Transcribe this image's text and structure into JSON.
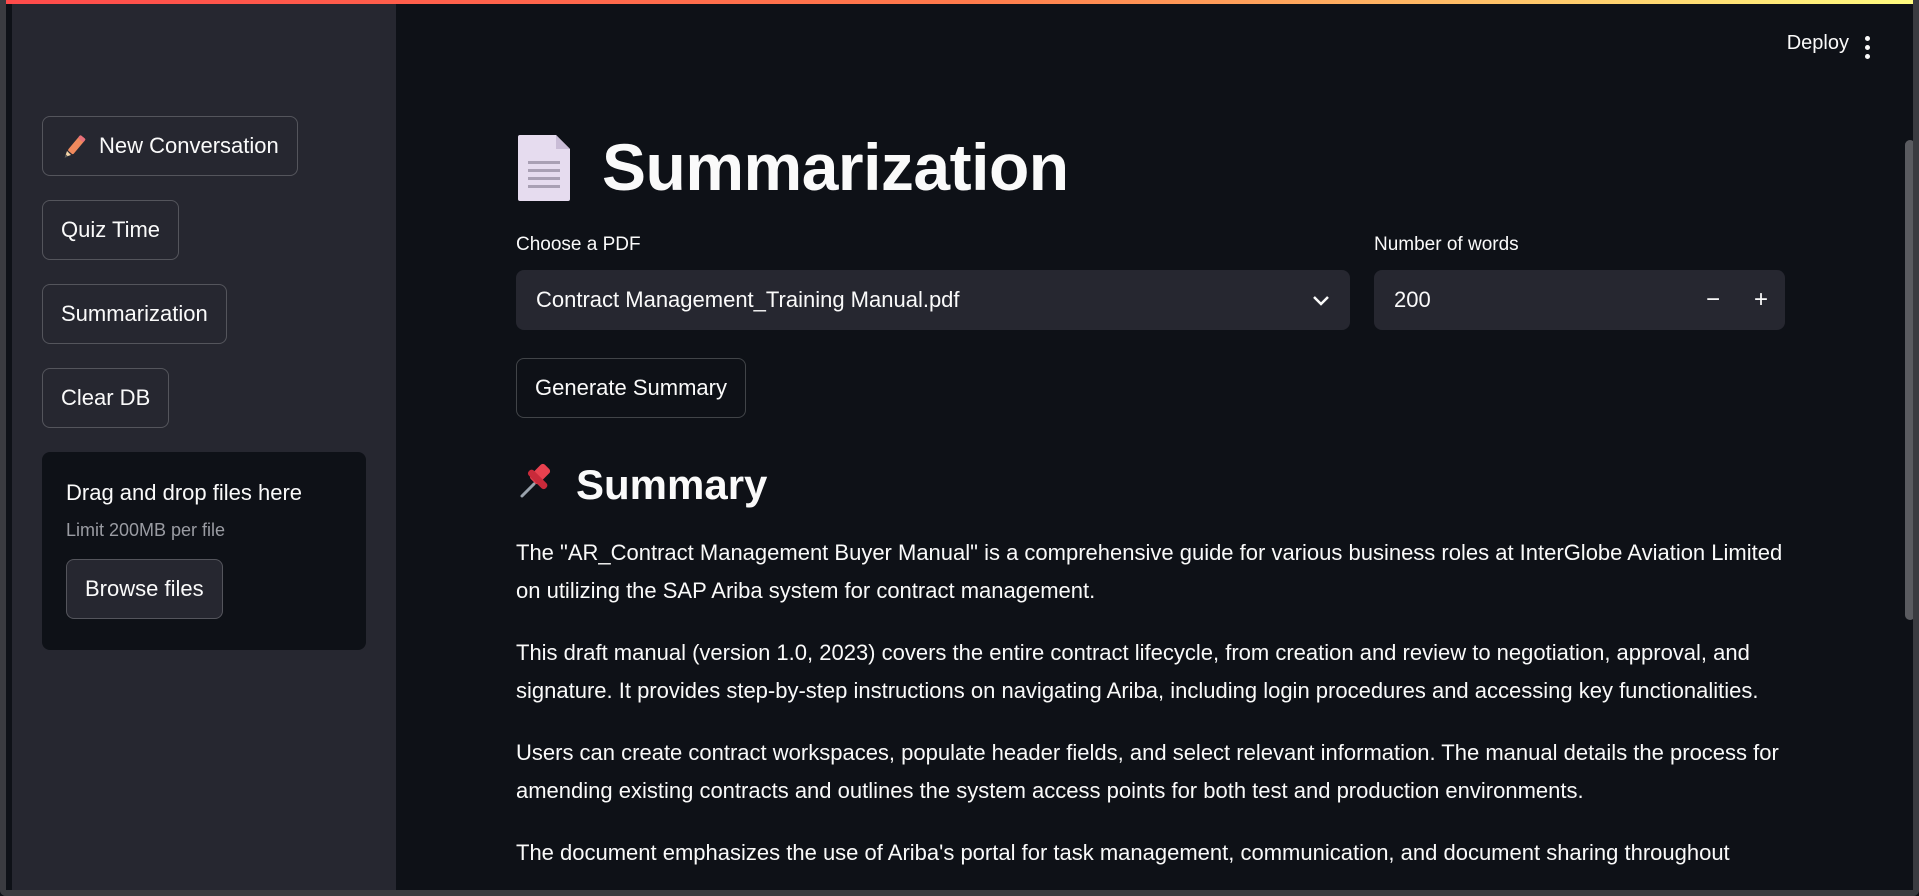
{
  "sidebar": {
    "buttons": [
      {
        "label": "New Conversation",
        "icon": "pencil-icon"
      },
      {
        "label": "Quiz Time"
      },
      {
        "label": "Summarization"
      },
      {
        "label": "Clear DB"
      }
    ],
    "uploader": {
      "title": "Drag and drop files here",
      "subtitle": "Limit 200MB per file",
      "browse_label": "Browse files"
    }
  },
  "header": {
    "deploy_label": "Deploy",
    "menu_icon": "kebab-menu-icon"
  },
  "main": {
    "title": "Summarization",
    "title_icon": "document-icon",
    "pdf_select": {
      "label": "Choose a PDF",
      "value": "Contract Management_Training Manual.pdf"
    },
    "words_input": {
      "label": "Number of words",
      "value": "200",
      "minus": "−",
      "plus": "+"
    },
    "generate_label": "Generate Summary",
    "summary_heading": "Summary",
    "summary_icon": "pushpin-icon",
    "paragraphs": [
      "The \"AR_Contract Management Buyer Manual\" is a comprehensive guide for various business roles at InterGlobe Aviation Limited on utilizing the SAP Ariba system for contract management.",
      "This draft manual (version 1.0, 2023) covers the entire contract lifecycle, from creation and review to negotiation, approval, and signature. It provides step-by-step instructions on navigating Ariba, including login procedures and accessing key functionalities.",
      "Users can create contract workspaces, populate header fields, and select relevant information. The manual details the process for amending existing contracts and outlines the system access points for both test and production environments.",
      "The document emphasizes the use of Ariba's portal for task management, communication, and document sharing throughout"
    ]
  },
  "colors": {
    "background": "#0e1117",
    "sidebar": "#262730",
    "accent_gradient_start": "#ff4b4b",
    "accent_gradient_end": "#fffd80"
  }
}
